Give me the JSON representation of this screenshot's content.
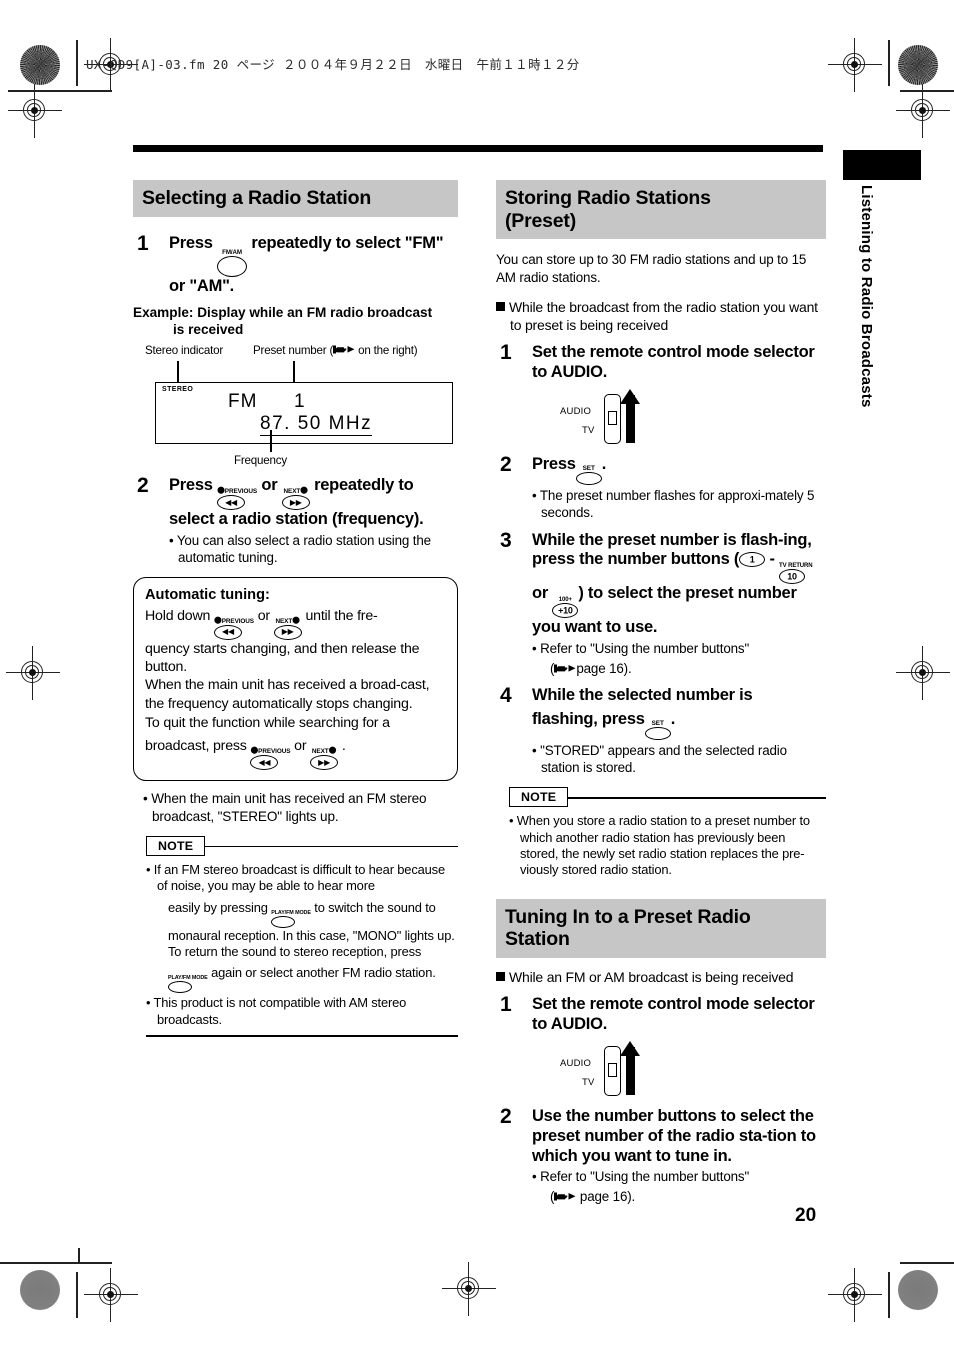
{
  "print_header": {
    "text": "UX-QD9[A]-03.fm  20 ページ  ２００４年９月２２日　水曜日　午前１１時１２分"
  },
  "side_tab": {
    "label": "Listening to Radio Broadcasts"
  },
  "page_number": "20",
  "left_column": {
    "section_title": "Selecting a Radio Station",
    "step1": {
      "num": "1",
      "text_before": "Press",
      "button_caption": "FM/AM",
      "text_after": "repeatedly to select \"FM\" or \"AM\"."
    },
    "example_label_line1": "Example: Display while an FM radio broadcast",
    "example_label_line2": "is received",
    "display": {
      "callout_stereo": "Stereo indicator",
      "callout_preset_pre": "Preset number (",
      "callout_preset_post": " on the right)",
      "callout_frequency": "Frequency",
      "stereo_text": "STEREO",
      "band": "FM",
      "preset_number": "1",
      "frequency": "87. 50  MHz"
    },
    "step2": {
      "num": "2",
      "text_before": "Press",
      "btn1_caption": "PREVIOUS",
      "or": "or",
      "btn2_caption": "NEXT",
      "text_after": "repeatedly to select a radio station (frequency).",
      "bullet": "• You can also select a radio station using the automatic tuning."
    },
    "auto_tuning_box": {
      "title": "Automatic tuning:",
      "line1_pre": "Hold down",
      "line1_or": "or",
      "line1_post": "until the fre-",
      "line2": "quency starts changing, and then release the button.",
      "line3": "When the main unit has received a broad-cast, the frequency automatically stops changing.",
      "line4": "To quit the function while searching for a",
      "line5_pre": "broadcast, press",
      "line5_or": "or",
      "line5_post": "."
    },
    "stereo_bullet": "• When the main unit has received an FM stereo broadcast, \"STEREO\" lights up.",
    "note": {
      "label": "NOTE",
      "item1_a": "• If an FM stereo broadcast is difficult to hear because of noise, you may be able to hear more",
      "item1_b_pre": "easily by pressing",
      "item1_b_post": "to switch the sound to monaural reception. In this case, \"MONO\" lights up. To return the sound to stereo reception, press",
      "item1_c": "again or select another FM radio station.",
      "mode_caption": "PLAY/FM MODE",
      "item2": "• This product is not compatible with AM stereo broadcasts."
    }
  },
  "right_column": {
    "section1_title_line1": "Storing Radio Stations",
    "section1_title_line2": "(Preset)",
    "intro": "You can store up to 30 FM radio stations and up to 15 AM radio stations.",
    "condition": "While the broadcast from the radio station you want to preset is being received",
    "step1": {
      "num": "1",
      "text": "Set the remote control mode selector to AUDIO.",
      "switch_top_label": "AUDIO",
      "switch_bottom_label": "TV"
    },
    "step2": {
      "num": "2",
      "text_before": "Press",
      "button_caption": "SET",
      "text_after": ".",
      "bullet": "• The preset number flashes for approxi-mately 5 seconds."
    },
    "step3": {
      "num": "3",
      "text_a": "While the preset number is flash-ing, press the number buttons (",
      "btn_1": "1",
      "dash": "-",
      "btn_10_caption": "TV RETURN",
      "btn_10": "10",
      "or": "or",
      "btn_plus10_caption": "100+",
      "btn_plus10": "+10",
      "text_b": ") to select the preset number you want to use.",
      "bullet_a": "• Refer to \"Using the number buttons\"",
      "bullet_b_pre": "(",
      "bullet_b_post": "page 16)."
    },
    "step4": {
      "num": "4",
      "text_a": "While the selected number is",
      "text_b": "flashing, press",
      "button_caption": "SET",
      "text_c": ".",
      "bullet": "• \"STORED\" appears and the selected radio station is stored."
    },
    "note": {
      "label": "NOTE",
      "item1": "• When you store a radio station to a preset number to which another radio station has previously been stored, the newly set radio station replaces the pre-viously stored radio station."
    },
    "section2_title_line1": "Tuning In to a Preset Radio",
    "section2_title_line2": "Station",
    "section2_condition": "While an FM or AM broadcast is being received",
    "section2_step1": {
      "num": "1",
      "text": "Set the remote control mode selector to AUDIO.",
      "switch_top_label": "AUDIO",
      "switch_bottom_label": "TV"
    },
    "section2_step2": {
      "num": "2",
      "text": "Use the number buttons to select the preset number of the radio sta-tion to which you want to tune in.",
      "bullet_a": "• Refer to \"Using the number buttons\"",
      "bullet_b_pre": "(",
      "bullet_b_post": "page 16)."
    }
  },
  "colors": {
    "heading_bg": "#c6c6c6",
    "ink": "#000000"
  }
}
